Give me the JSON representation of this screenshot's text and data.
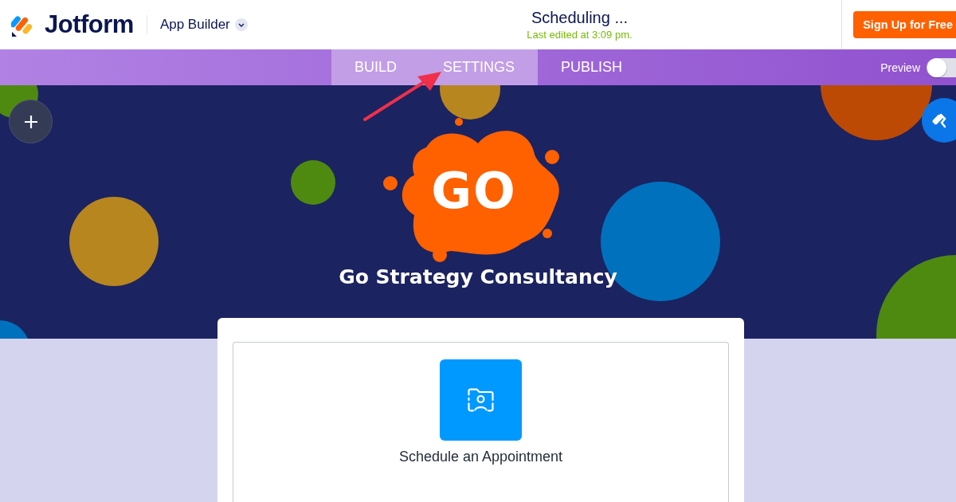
{
  "header": {
    "brand": "Jotform",
    "product": "App Builder",
    "title": "Scheduling ...",
    "subtitle": "Last edited at 3:09 pm.",
    "signup": "Sign Up for Free"
  },
  "tabs": [
    {
      "label": "BUILD",
      "highlighted": true
    },
    {
      "label": "SETTINGS",
      "highlighted": true
    },
    {
      "label": "PUBLISH",
      "highlighted": false
    }
  ],
  "preview": {
    "label": "Preview",
    "on": false
  },
  "app": {
    "logo_text": "GO",
    "name": "Go Strategy Consultancy"
  },
  "items": [
    {
      "label": "Schedule an Appointment"
    }
  ]
}
